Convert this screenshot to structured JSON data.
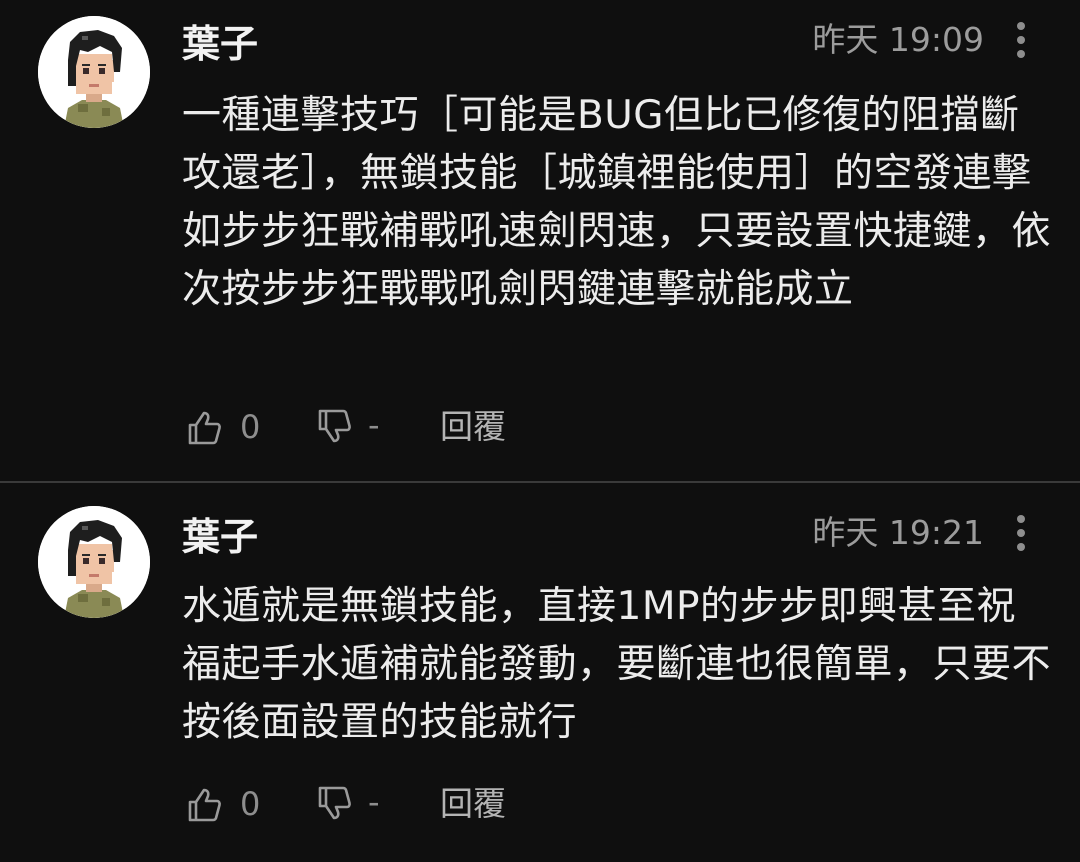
{
  "comments": [
    {
      "username": "葉子",
      "timestamp": "昨天 19:09",
      "text": "一種連擊技巧［可能是BUG但比已修復的阻擋斷攻還老］，無鎖技能［城鎮裡能使用］的空發連擊如步步狂戰補戰吼速劍閃速，只要設置快捷鍵，依次按步步狂戰戰吼劍閃鍵連擊就能成立",
      "likes": "0",
      "dislikes": "-",
      "reply_label": "回覆"
    },
    {
      "username": "葉子",
      "timestamp": "昨天 19:21",
      "text": "水遁就是無鎖技能，直接1MP的步步即興甚至祝福起手水遁補就能發動，要斷連也很簡單，只要不按後面設置的技能就行",
      "likes": "0",
      "dislikes": "-",
      "reply_label": "回覆"
    }
  ],
  "icons": {
    "avatar": "pixel-character-avatar",
    "more": "vertical-dots-icon",
    "like": "thumbs-up-icon",
    "dislike": "thumbs-down-icon"
  },
  "colors": {
    "background": "#0f0f0f",
    "text": "#ececec",
    "muted": "#9c9c9c"
  }
}
